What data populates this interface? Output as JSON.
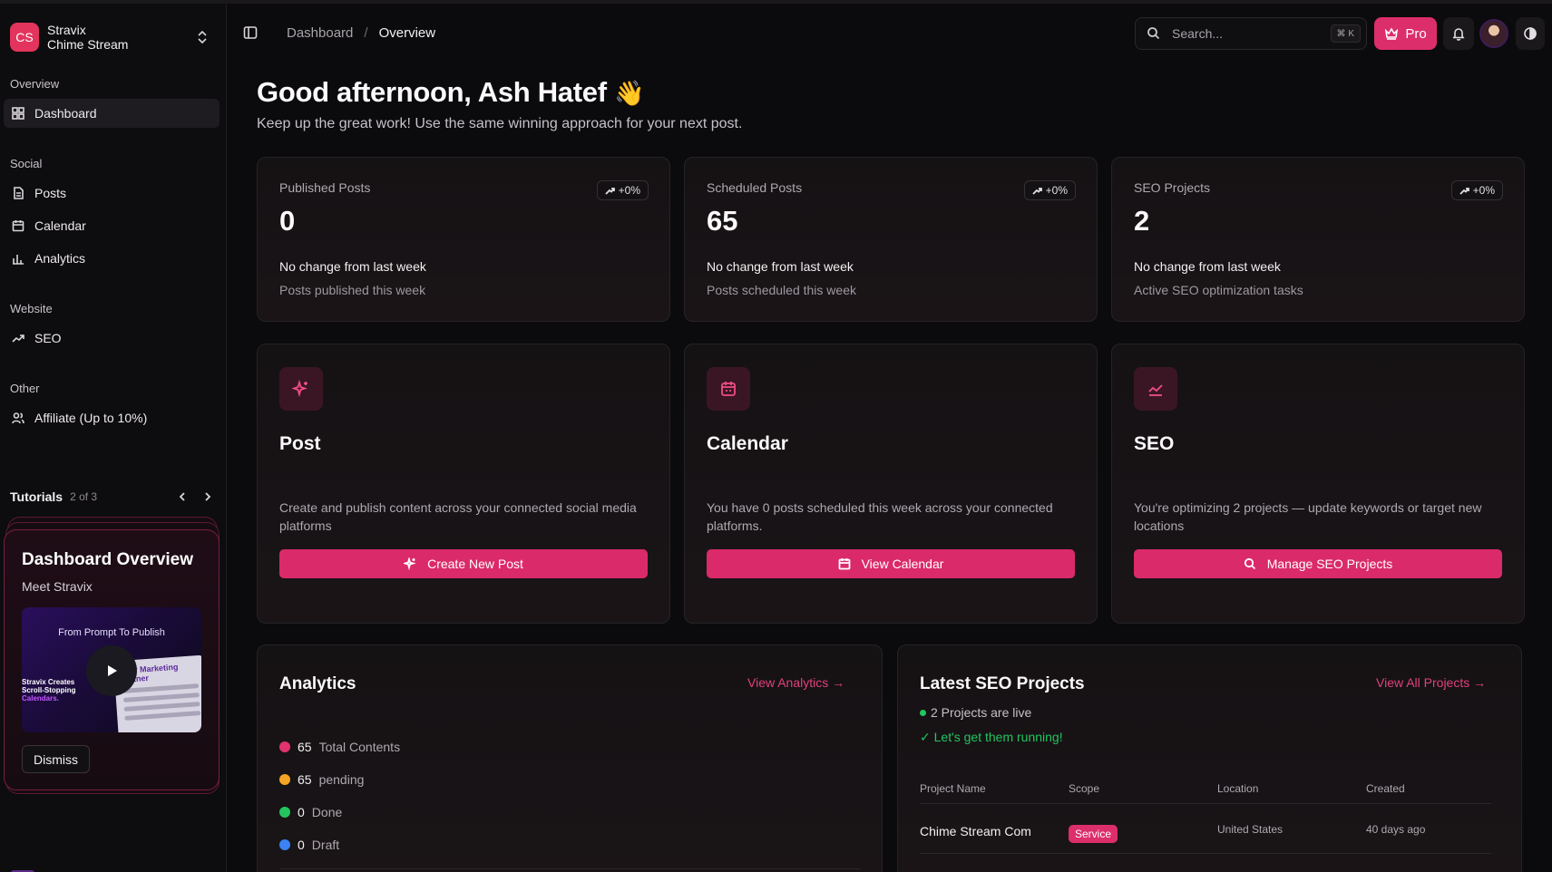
{
  "workspace": {
    "initials": "CS",
    "name": "Stravix",
    "subtitle": "Chime Stream"
  },
  "sidebar": {
    "sections": [
      {
        "label": "Overview",
        "items": [
          {
            "label": "Dashboard",
            "icon": "grid-icon",
            "active": true
          }
        ]
      },
      {
        "label": "Social",
        "items": [
          {
            "label": "Posts",
            "icon": "document-icon"
          },
          {
            "label": "Calendar",
            "icon": "calendar-icon"
          },
          {
            "label": "Analytics",
            "icon": "bar-chart-icon"
          }
        ]
      },
      {
        "label": "Website",
        "items": [
          {
            "label": "SEO",
            "icon": "trending-up-icon"
          }
        ]
      },
      {
        "label": "Other",
        "items": [
          {
            "label": "Affiliate (Up to 10%)",
            "icon": "users-icon"
          }
        ]
      }
    ],
    "tutorials": {
      "title": "Tutorials",
      "count": "2 of 3",
      "card": {
        "title": "Dashboard Overview",
        "subtitle": "Meet Stravix",
        "thumb_heading": "From Prompt To Publish",
        "thumb_left": [
          "Stravix Creates",
          "Scroll-Stopping",
          "Calendars."
        ],
        "thumb_panel_title": "Your Marketing Partner",
        "dismiss_label": "Dismiss"
      }
    }
  },
  "topbar": {
    "breadcrumb": [
      "Dashboard",
      "/",
      "Overview"
    ],
    "search_placeholder": "Search...",
    "search_shortcut": "⌘ K",
    "pro_label": "Pro"
  },
  "greeting": {
    "title": "Good afternoon, Ash Hatef",
    "emoji": "👋",
    "subtitle": "Keep up the great work! Use the same winning approach for your next post."
  },
  "stats": [
    {
      "label": "Published Posts",
      "value": "0",
      "badge": "+0%",
      "change": "No change from last week",
      "note": "Posts published this week"
    },
    {
      "label": "Scheduled Posts",
      "value": "65",
      "badge": "+0%",
      "change": "No change from last week",
      "note": "Posts scheduled this week"
    },
    {
      "label": "SEO Projects",
      "value": "2",
      "badge": "+0%",
      "change": "No change from last week",
      "note": "Active SEO optimization tasks"
    }
  ],
  "actions": [
    {
      "title": "Post",
      "icon": "sparkles-icon",
      "desc": "Create and publish content across your connected social media platforms",
      "button": "Create New Post"
    },
    {
      "title": "Calendar",
      "icon": "calendar-icon",
      "desc": "You have 0 posts scheduled this week across your connected platforms.",
      "button": "View Calendar"
    },
    {
      "title": "SEO",
      "icon": "area-chart-icon",
      "desc": "You're optimizing 2 projects — update keywords or target new locations",
      "button": "Manage SEO Projects"
    }
  ],
  "analytics": {
    "title": "Analytics",
    "link": "View Analytics →",
    "rows": [
      {
        "num": "65",
        "label": "Total Contents",
        "color": "#e2336d"
      },
      {
        "num": "65",
        "label": "pending",
        "color": "#f5a524"
      },
      {
        "num": "0",
        "label": "Done",
        "color": "#22c55e"
      },
      {
        "num": "0",
        "label": "Draft",
        "color": "#3b82f6"
      }
    ]
  },
  "seo_projects": {
    "title": "Latest SEO Projects",
    "link": "View All Projects →",
    "live": "2 Projects are live",
    "running": "✓ Let's get them running!",
    "columns": [
      "Project Name",
      "Scope",
      "Location",
      "Created"
    ],
    "rows": [
      {
        "name": "Chime Stream Com",
        "scope": "Service",
        "location": "United States",
        "created": "40 days ago"
      }
    ]
  },
  "colors": {
    "accent": "#dc2e6a",
    "accent_text": "#e0417a",
    "background": "#0b0a0c",
    "success": "#22c55e"
  }
}
